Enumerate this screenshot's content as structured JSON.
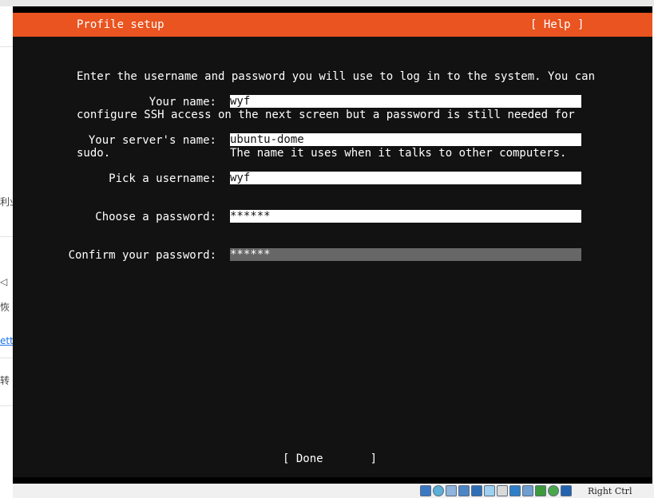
{
  "host": {
    "left_fragments": [
      "利业",
      "◁",
      "恢",
      "etti",
      "转"
    ]
  },
  "installer": {
    "header": {
      "title": "Profile setup",
      "help": "[ Help ]"
    },
    "intro": [
      "Enter the username and password you will use to log in to the system. You can",
      "configure SSH access on the next screen but a password is still needed for",
      "sudo."
    ],
    "fields": {
      "your_name": {
        "label": "Your name:",
        "value": "wyf"
      },
      "server_name": {
        "label": "Your server's name:",
        "value": "ubuntu-dome",
        "hint": "The name it uses when it talks to other computers."
      },
      "username": {
        "label": "Pick a username:",
        "value": "wyf"
      },
      "password": {
        "label": "Choose a password:",
        "value": "******"
      },
      "confirm_password": {
        "label": "Confirm your password:",
        "value": "******"
      }
    },
    "done_button": "[ Done       ]"
  },
  "statusbar": {
    "icons": [
      "hard-disk-icon",
      "optical-drive-icon",
      "audio-icon",
      "network-icon",
      "usb-icon",
      "shared-folder-icon",
      "display-icon",
      "video-capture-icon",
      "cpu-icon",
      "keyboard-capture-icon",
      "mouse-capture-icon"
    ],
    "host_key": "Right Ctrl"
  }
}
